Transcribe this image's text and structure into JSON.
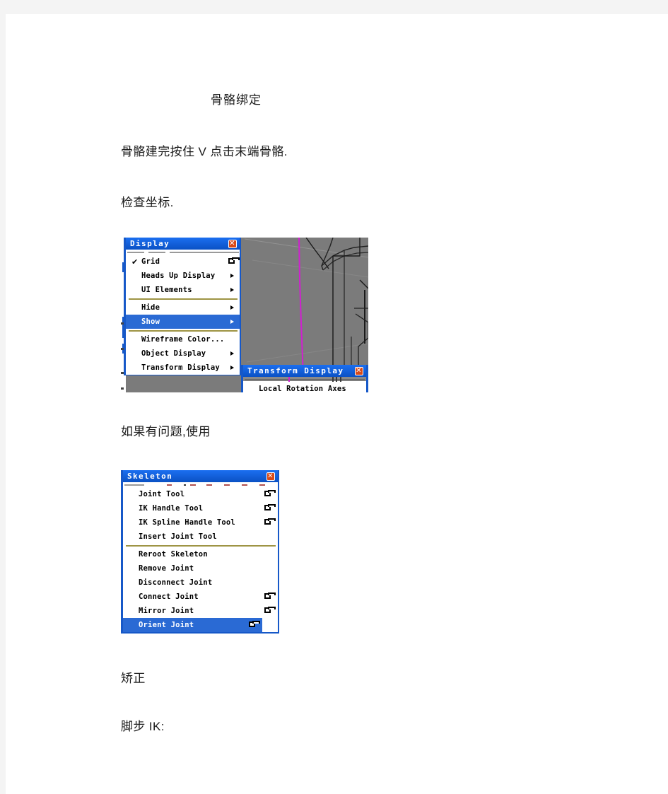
{
  "document": {
    "title": "骨骼绑定",
    "paragraphs": [
      "骨骼建完按住 V 点击末端骨骼.",
      "检查坐标.",
      "如果有问题,使用",
      "矫正",
      "脚步 IK:"
    ]
  },
  "colors": {
    "title_bar": "#1060e0",
    "highlight": "#2a6ad4",
    "close_button": "#d84a18",
    "separator": "#9e9444",
    "viewport_bg": "#7b7b7b",
    "wire_magenta": "#d020d0",
    "page_margin": "#f4f4f4"
  },
  "display_window": {
    "title": "Display",
    "close_label": "✕",
    "items": [
      {
        "label": "Grid",
        "checked": true,
        "submenu": false,
        "option_box": true,
        "selected": false
      },
      {
        "label": "Heads Up Display",
        "checked": false,
        "submenu": true,
        "option_box": false,
        "selected": false
      },
      {
        "label": "UI Elements",
        "checked": false,
        "submenu": true,
        "option_box": false,
        "selected": false
      },
      {
        "separator": true
      },
      {
        "label": "Hide",
        "checked": false,
        "submenu": true,
        "option_box": false,
        "selected": false
      },
      {
        "label": "Show",
        "checked": false,
        "submenu": true,
        "option_box": false,
        "selected": true
      },
      {
        "separator": true
      },
      {
        "label": "Wireframe Color...",
        "checked": false,
        "submenu": false,
        "option_box": false,
        "selected": false
      },
      {
        "label": "Object Display",
        "checked": false,
        "submenu": true,
        "option_box": false,
        "selected": false
      },
      {
        "label": "Transform Display",
        "checked": false,
        "submenu": true,
        "option_box": false,
        "selected": false
      }
    ]
  },
  "transform_display_window": {
    "title": "Transform Display",
    "close_label": "✕",
    "items": [
      {
        "label": "Local Rotation Axes",
        "checked": false,
        "submenu": false,
        "option_box": false,
        "selected": false
      }
    ]
  },
  "skeleton_window": {
    "title": "Skeleton",
    "close_label": "✕",
    "items": [
      {
        "label": "Joint Tool",
        "checked": false,
        "submenu": false,
        "option_box": true,
        "selected": false
      },
      {
        "label": "IK Handle Tool",
        "checked": false,
        "submenu": false,
        "option_box": true,
        "selected": false
      },
      {
        "label": "IK Spline Handle Tool",
        "checked": false,
        "submenu": false,
        "option_box": true,
        "selected": false
      },
      {
        "label": "Insert Joint Tool",
        "checked": false,
        "submenu": false,
        "option_box": false,
        "selected": false
      },
      {
        "separator": true
      },
      {
        "label": "Reroot Skeleton",
        "checked": false,
        "submenu": false,
        "option_box": false,
        "selected": false
      },
      {
        "label": "Remove Joint",
        "checked": false,
        "submenu": false,
        "option_box": false,
        "selected": false
      },
      {
        "label": "Disconnect Joint",
        "checked": false,
        "submenu": false,
        "option_box": false,
        "selected": false
      },
      {
        "label": "Connect Joint",
        "checked": false,
        "submenu": false,
        "option_box": true,
        "selected": false
      },
      {
        "label": "Mirror Joint",
        "checked": false,
        "submenu": false,
        "option_box": true,
        "selected": false
      },
      {
        "label": "Orient Joint",
        "checked": false,
        "submenu": false,
        "option_box": true,
        "selected": true
      }
    ]
  }
}
